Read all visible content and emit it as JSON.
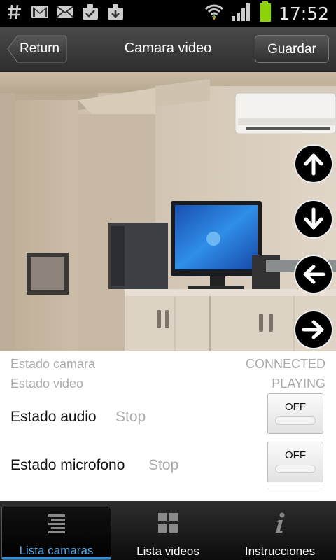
{
  "status_bar": {
    "time": "17:52"
  },
  "header": {
    "title": "Camara video",
    "return_label": "Return",
    "save_label": "Guardar"
  },
  "status": {
    "camera_label": "Estado camara",
    "camera_value": "CONNECTED",
    "video_label": "Estado video",
    "video_value": "PLAYING",
    "audio_label": "Estado audio",
    "audio_value": "Stop",
    "audio_toggle": "OFF",
    "mic_label": "Estado microfono",
    "mic_value": "Stop",
    "mic_toggle": "OFF"
  },
  "tabs": [
    {
      "label": "Lista camaras",
      "active": true
    },
    {
      "label": "Lista videos",
      "active": false
    },
    {
      "label": "Instrucciones",
      "active": false
    }
  ],
  "colors": {
    "accent": "#59a9e8",
    "battery": "#8ed20a"
  }
}
